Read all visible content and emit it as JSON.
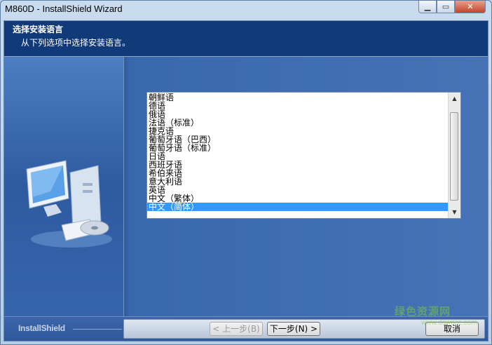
{
  "window": {
    "title": "M860D - InstallShield Wizard",
    "controls": {
      "minimize": "▭",
      "restore": "▭",
      "close": "X"
    }
  },
  "header": {
    "title": "选择安装语言",
    "subtitle": "从下列选项中选择安装语言。"
  },
  "language_list": {
    "items": [
      "朝鲜语",
      "德语",
      "俄语",
      "法语（标准）",
      "捷克语",
      "葡萄牙语（巴西）",
      "葡萄牙语（标准）",
      "日语",
      "西班牙语",
      "希伯来语",
      "意大利语",
      "英语",
      "中文（繁体）",
      "中文（简体）"
    ],
    "selected": "中文（简体）",
    "scroll_up": "▲",
    "scroll_down": "▼"
  },
  "footer": {
    "brand": "InstallShield",
    "back_label": "< 上一步(B)",
    "next_label": "下一步(N) >",
    "cancel_label": "取消"
  },
  "watermark": {
    "text": "绿色资源网",
    "sub": "www.downcc.com"
  },
  "colors": {
    "header_bg": "#103a78",
    "body_bg": "#3a64a6",
    "selection": "#3399ff"
  }
}
